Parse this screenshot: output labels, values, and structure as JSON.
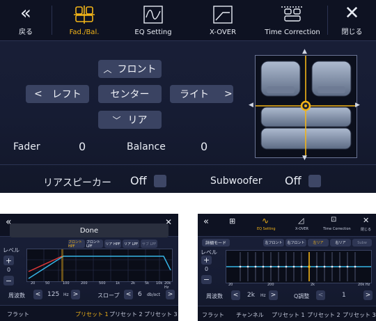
{
  "main": {
    "topbar": {
      "back_label": "戻る",
      "tabs": [
        {
          "label": "Fad./Bal.",
          "icon": "seat-balance-icon",
          "active": true
        },
        {
          "label": "EQ Setting",
          "icon": "eq-wave-icon",
          "active": false
        },
        {
          "label": "X-OVER",
          "icon": "crossover-icon",
          "active": false
        },
        {
          "label": "Time Correction",
          "icon": "time-correction-icon",
          "active": false
        }
      ],
      "close_label": "閉じる"
    },
    "front_label": "フロント",
    "left_label": "レフト",
    "center_label": "センター",
    "right_label": "ライト",
    "rear_label": "リア",
    "fader_label": "Fader",
    "fader_value": "0",
    "balance_label": "Balance",
    "balance_value": "0",
    "rear_speaker_label": "リアスピーカー",
    "rear_speaker_value": "Off",
    "subwoofer_label": "Subwoofer",
    "subwoofer_value": "Off"
  },
  "xover": {
    "done_label": "Done",
    "level_label": "レベル",
    "level_value": "0",
    "channel_buttons": [
      "フロント HPF",
      "フロント LPF",
      "リア HPF",
      "リア LPF",
      "サブ LPF"
    ],
    "x_ticks": [
      "20",
      "50",
      "100",
      "200",
      "500",
      "1k",
      "2k",
      "5k",
      "10k",
      "20k Hz"
    ],
    "freq_label": "周波数",
    "freq_value": "125",
    "freq_unit": "Hz",
    "slope_label": "スロープ",
    "slope_value": "6",
    "slope_unit": "db/oct",
    "footer": [
      "フラット",
      "プリセット 1",
      "プリセット 2",
      "プリセット 3"
    ],
    "colors": {
      "curve_blue": "#36b5e6",
      "curve_red": "#e03838",
      "accent": "#f2b418"
    }
  },
  "eq": {
    "tabs": [
      "",
      "EQ Setting",
      "X-OVER",
      "Time Correction",
      "閉じる"
    ],
    "detail_mode_label": "詳細モード",
    "speaker_buttons": [
      "左フロント",
      "右フロント",
      "左リア",
      "右リア",
      "Subw"
    ],
    "level_label": "レベル",
    "level_value": "0",
    "x_ticks": [
      "20",
      "200",
      "2k",
      "20k Hz"
    ],
    "freq_label": "周波数",
    "freq_value": "2k",
    "freq_unit": "Hz",
    "q_label": "Q調整",
    "q_value": "1",
    "footer": [
      "フラット",
      "チャンネル",
      "プリセット 1",
      "プリセット 2",
      "プリセット 3"
    ]
  }
}
